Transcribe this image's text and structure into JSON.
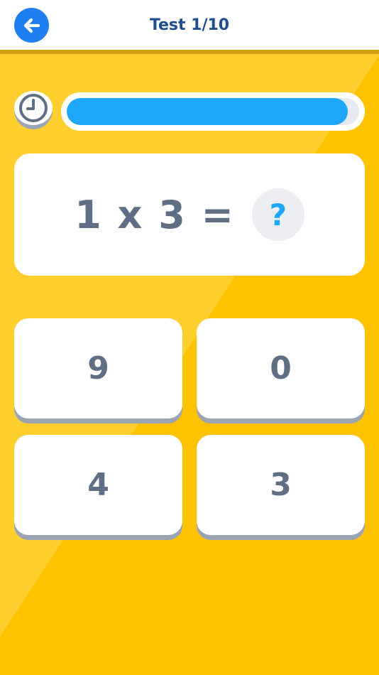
{
  "header": {
    "title": "Test 1/10",
    "back_icon": "arrow-left-icon"
  },
  "timer": {
    "icon": "clock-icon",
    "progress_fraction": 0.96
  },
  "question": {
    "expression": "1 x 3 =",
    "placeholder": "?"
  },
  "answers": [
    {
      "label": "9"
    },
    {
      "label": "0"
    },
    {
      "label": "4"
    },
    {
      "label": "3"
    }
  ],
  "colors": {
    "background": "#fec200",
    "accent_blue": "#1d7ff0",
    "progress": "#1ea6f8",
    "text": "#5e6f85",
    "title": "#1d4f8f"
  }
}
